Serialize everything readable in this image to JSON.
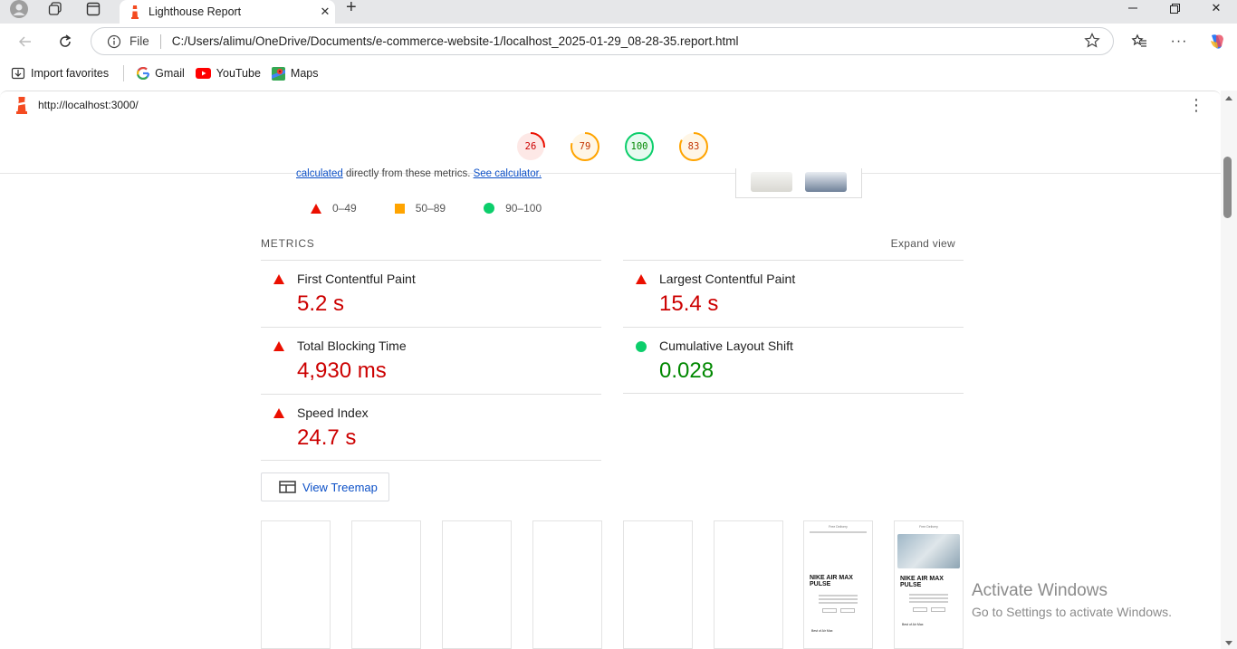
{
  "browser": {
    "tab_title": "Lighthouse Report",
    "address_scheme": "File",
    "address_path": "C:/Users/alimu/OneDrive/Documents/e-commerce-website-1/localhost_2025-01-29_08-28-35.report.html",
    "bookmarks": [
      "Import favorites",
      "Gmail",
      "YouTube",
      "Maps"
    ]
  },
  "report": {
    "url": "http://localhost:3000/",
    "gauges": [
      {
        "category": "performance",
        "score": "26",
        "fraction": 0.26,
        "color": "#eb0f00",
        "bg": "#fde8e6"
      },
      {
        "category": "accessibility",
        "score": "79",
        "fraction": 0.79,
        "color": "#ffa400",
        "bg": "#fff6e6"
      },
      {
        "category": "best-practices",
        "score": "100",
        "fraction": 1.0,
        "color": "#0cce6b",
        "bg": "#e7faf0"
      },
      {
        "category": "seo",
        "score": "83",
        "fraction": 0.83,
        "color": "#ffa400",
        "bg": "#fff6e6"
      }
    ],
    "partial_text": {
      "link1": "calculated",
      "middle": " directly from these metrics. ",
      "link2": "See calculator."
    },
    "legend": {
      "fail": "0–49",
      "average": "50–89",
      "pass": "90–100"
    },
    "metrics_title": "METRICS",
    "expand_view": "Expand view",
    "metrics": {
      "fcp": {
        "name": "First Contentful Paint",
        "value": "5.2 s",
        "status": "fail"
      },
      "lcp": {
        "name": "Largest Contentful Paint",
        "value": "15.4 s",
        "status": "fail"
      },
      "tbt": {
        "name": "Total Blocking Time",
        "value": "4,930 ms",
        "status": "fail"
      },
      "cls": {
        "name": "Cumulative Layout Shift",
        "value": "0.028",
        "status": "pass"
      },
      "si": {
        "name": "Speed Index",
        "value": "24.7 s",
        "status": "fail"
      }
    },
    "treemap_button": "View Treemap",
    "filmstrip": {
      "frame_top": "Free Delivery",
      "product_title": "NIKE AIR MAX PULSE",
      "section_label": "Best of Air Max"
    }
  },
  "watermark": {
    "line1": "Activate Windows",
    "line2": "Go to Settings to activate Windows."
  }
}
